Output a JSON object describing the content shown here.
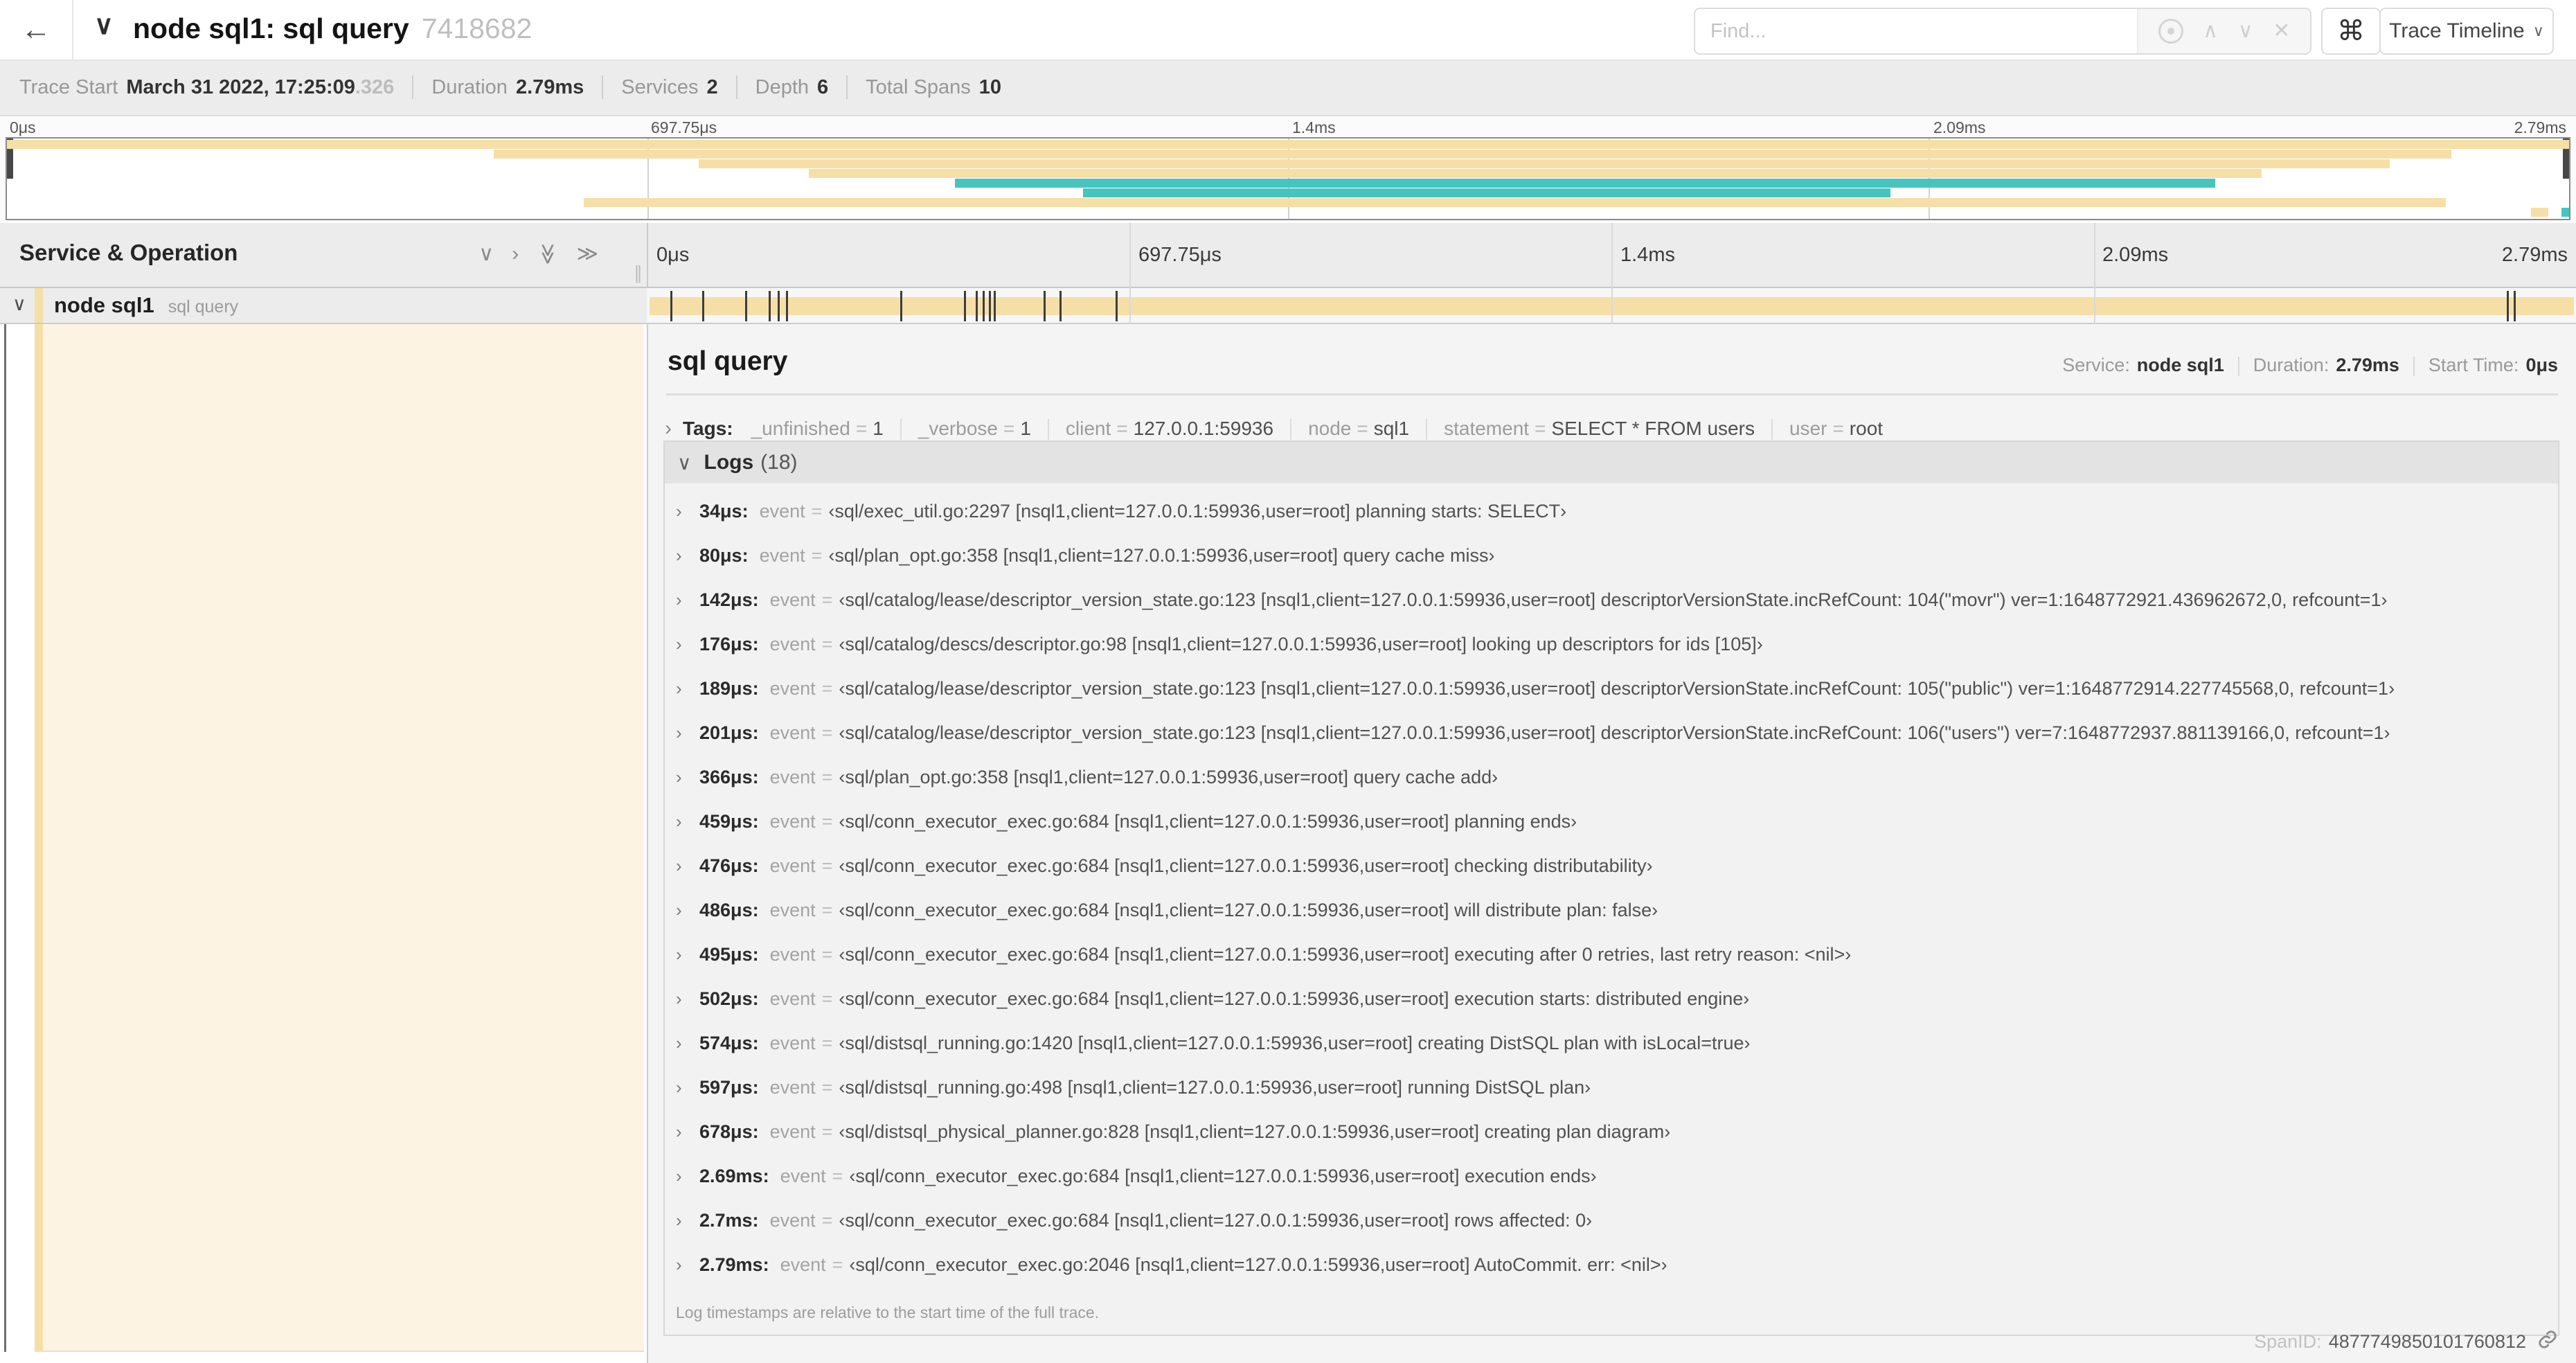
{
  "header": {
    "title": "node sql1: sql query",
    "trace_id": "7418682",
    "find_placeholder": "Find...",
    "view_selector": "Trace Timeline"
  },
  "icons": {
    "back": "←",
    "chevron_down": "∨",
    "chevron_right": "›",
    "chevron_up": "∧",
    "double_chevron_right": "≫",
    "clear": "✕",
    "command": "⌘",
    "caret_down": "∨",
    "resizer_grip": "∥"
  },
  "summary": {
    "items": [
      {
        "label": "Trace Start",
        "value": "March 31 2022, 17:25:09",
        "suffix": ".326"
      },
      {
        "label": "Duration",
        "value": "2.79ms"
      },
      {
        "label": "Services",
        "value": "2"
      },
      {
        "label": "Depth",
        "value": "6"
      },
      {
        "label": "Total Spans",
        "value": "10"
      }
    ]
  },
  "timeline": {
    "axis_ticks": [
      {
        "label": "0μs",
        "pos": 0
      },
      {
        "label": "697.75μs",
        "pos": 0.25
      },
      {
        "label": "1.4ms",
        "pos": 0.5
      },
      {
        "label": "2.09ms",
        "pos": 0.75
      },
      {
        "label": "2.79ms",
        "pos": 1
      }
    ],
    "gridline_positions": [
      0.25,
      0.5,
      0.75
    ],
    "colors": {
      "tan": "#f6dfa7",
      "teal": "#46c5c0"
    },
    "minimap": {
      "segments": [
        {
          "row": 0,
          "start": 0.0,
          "end": 1.0,
          "color": "tan"
        },
        {
          "row": 1,
          "start": 0.19,
          "end": 0.954,
          "color": "tan"
        },
        {
          "row": 2,
          "start": 0.27,
          "end": 0.93,
          "color": "tan"
        },
        {
          "row": 3,
          "start": 0.313,
          "end": 0.88,
          "color": "tan"
        },
        {
          "row": 4,
          "start": 0.37,
          "end": 0.862,
          "color": "teal"
        },
        {
          "row": 5,
          "start": 0.42,
          "end": 0.735,
          "color": "teal"
        },
        {
          "row": 6,
          "start": 0.225,
          "end": 0.952,
          "color": "tan"
        },
        {
          "row": 7,
          "start": 0.985,
          "end": 0.992,
          "color": "tan"
        },
        {
          "row": 7,
          "start": 0.997,
          "end": 1.0,
          "color": "teal"
        }
      ]
    },
    "span_row": {
      "bar_color": "tan",
      "log_marker_positions": [
        0.0122,
        0.0287,
        0.0509,
        0.0631,
        0.0677,
        0.072,
        0.1312,
        0.1645,
        0.1706,
        0.1742,
        0.1774,
        0.1799,
        0.2057,
        0.214,
        0.243,
        0.9642,
        0.9677
      ]
    }
  },
  "left_panel": {
    "header": "Service & Operation",
    "row": {
      "service": "node sql1",
      "operation": "sql query"
    }
  },
  "detail": {
    "title": "sql query",
    "meta": [
      {
        "label": "Service:",
        "value": "node sql1"
      },
      {
        "label": "Duration:",
        "value": "2.79ms"
      },
      {
        "label": "Start Time:",
        "value": "0μs"
      }
    ],
    "tags_label": "Tags:",
    "tags": [
      {
        "key": "_unfinished",
        "value": "1"
      },
      {
        "key": "_verbose",
        "value": "1"
      },
      {
        "key": "client",
        "value": "127.0.0.1:59936"
      },
      {
        "key": "node",
        "value": "sql1"
      },
      {
        "key": "statement",
        "value": "SELECT * FROM users"
      },
      {
        "key": "user",
        "value": "root"
      }
    ],
    "logs_label": "Logs",
    "logs_count": "(18)",
    "log_field": "event",
    "logs": [
      {
        "time": "34μs:",
        "value": "‹sql/exec_util.go:2297 [nsql1,client=127.0.0.1:59936,user=root] planning starts: SELECT›"
      },
      {
        "time": "80μs:",
        "value": "‹sql/plan_opt.go:358 [nsql1,client=127.0.0.1:59936,user=root] query cache miss›"
      },
      {
        "time": "142μs:",
        "value": "‹sql/catalog/lease/descriptor_version_state.go:123 [nsql1,client=127.0.0.1:59936,user=root] descriptorVersionState.incRefCount: 104(\"movr\") ver=1:1648772921.436962672,0, refcount=1›"
      },
      {
        "time": "176μs:",
        "value": "‹sql/catalog/descs/descriptor.go:98 [nsql1,client=127.0.0.1:59936,user=root] looking up descriptors for ids [105]›"
      },
      {
        "time": "189μs:",
        "value": "‹sql/catalog/lease/descriptor_version_state.go:123 [nsql1,client=127.0.0.1:59936,user=root] descriptorVersionState.incRefCount: 105(\"public\") ver=1:1648772914.227745568,0, refcount=1›"
      },
      {
        "time": "201μs:",
        "value": "‹sql/catalog/lease/descriptor_version_state.go:123 [nsql1,client=127.0.0.1:59936,user=root] descriptorVersionState.incRefCount: 106(\"users\") ver=7:1648772937.881139166,0, refcount=1›"
      },
      {
        "time": "366μs:",
        "value": "‹sql/plan_opt.go:358 [nsql1,client=127.0.0.1:59936,user=root] query cache add›"
      },
      {
        "time": "459μs:",
        "value": "‹sql/conn_executor_exec.go:684 [nsql1,client=127.0.0.1:59936,user=root] planning ends›"
      },
      {
        "time": "476μs:",
        "value": "‹sql/conn_executor_exec.go:684 [nsql1,client=127.0.0.1:59936,user=root] checking distributability›"
      },
      {
        "time": "486μs:",
        "value": "‹sql/conn_executor_exec.go:684 [nsql1,client=127.0.0.1:59936,user=root] will distribute plan: false›"
      },
      {
        "time": "495μs:",
        "value": "‹sql/conn_executor_exec.go:684 [nsql1,client=127.0.0.1:59936,user=root] executing after 0 retries, last retry reason: <nil>›"
      },
      {
        "time": "502μs:",
        "value": "‹sql/conn_executor_exec.go:684 [nsql1,client=127.0.0.1:59936,user=root] execution starts: distributed engine›"
      },
      {
        "time": "574μs:",
        "value": "‹sql/distsql_running.go:1420 [nsql1,client=127.0.0.1:59936,user=root] creating DistSQL plan with isLocal=true›"
      },
      {
        "time": "597μs:",
        "value": "‹sql/distsql_running.go:498 [nsql1,client=127.0.0.1:59936,user=root] running DistSQL plan›"
      },
      {
        "time": "678μs:",
        "value": "‹sql/distsql_physical_planner.go:828 [nsql1,client=127.0.0.1:59936,user=root] creating plan diagram›"
      },
      {
        "time": "2.69ms:",
        "value": "‹sql/conn_executor_exec.go:684 [nsql1,client=127.0.0.1:59936,user=root] execution ends›"
      },
      {
        "time": "2.7ms:",
        "value": "‹sql/conn_executor_exec.go:684 [nsql1,client=127.0.0.1:59936,user=root] rows affected: 0›"
      },
      {
        "time": "2.79ms:",
        "value": "‹sql/conn_executor_exec.go:2046 [nsql1,client=127.0.0.1:59936,user=root] AutoCommit. err: <nil>›"
      }
    ],
    "footnote": "Log timestamps are relative to the start time of the full trace.",
    "span_id_label": "SpanID:",
    "span_id": "4877749850101760812"
  }
}
